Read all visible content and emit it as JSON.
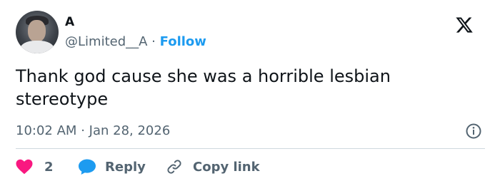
{
  "author": {
    "name": "A",
    "handle": "@Limited__A",
    "separator": "·",
    "follow_label": "Follow"
  },
  "brand": {
    "logo_icon": "x-logo-icon"
  },
  "tweet": {
    "text": "Thank god cause she was a horrible lesbian stereotype",
    "time": "10:02 AM",
    "dot": "·",
    "date": "Jan 28, 2026"
  },
  "actions": {
    "like_count": "2",
    "reply_label": "Reply",
    "copy_label": "Copy link"
  },
  "colors": {
    "like": "#f91880",
    "reply": "#1d9bf0",
    "follow": "#1d9bf0",
    "muted": "#536471",
    "text": "#0f1419"
  }
}
